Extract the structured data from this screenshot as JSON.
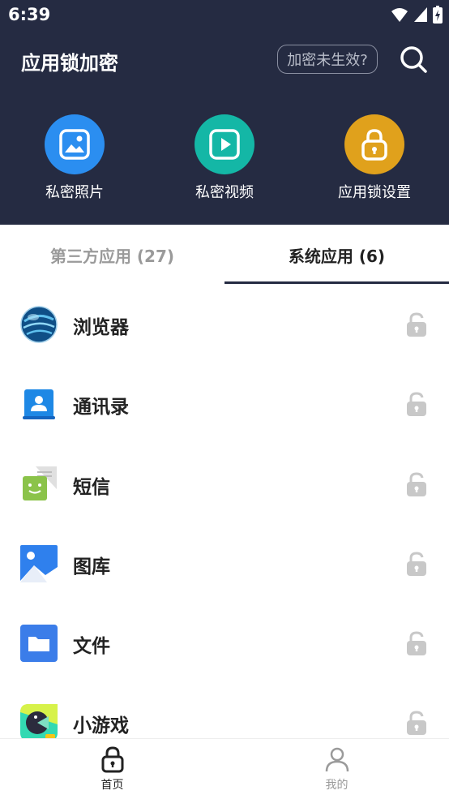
{
  "status_bar": {
    "time": "6:39"
  },
  "header": {
    "title": "应用锁加密",
    "status_pill": "加密未生效?",
    "search_icon": "search-icon"
  },
  "features": [
    {
      "label": "私密照片",
      "icon": "photo-icon",
      "color": "#2b8ef0"
    },
    {
      "label": "私密视频",
      "icon": "video-icon",
      "color": "#14b7a6"
    },
    {
      "label": "应用锁设置",
      "icon": "lock-icon",
      "color": "#e0a11c"
    }
  ],
  "tabs": {
    "third_party": "第三方应用 (27)",
    "system": "系统应用 (6)",
    "active": "system"
  },
  "apps": [
    {
      "name": "浏览器",
      "icon": "browser-icon",
      "locked": false
    },
    {
      "name": "通讯录",
      "icon": "contacts-icon",
      "locked": false
    },
    {
      "name": "短信",
      "icon": "messages-icon",
      "locked": false
    },
    {
      "name": "图库",
      "icon": "gallery-icon",
      "locked": false
    },
    {
      "name": "文件",
      "icon": "files-icon",
      "locked": false
    },
    {
      "name": "小游戏",
      "icon": "game-icon",
      "locked": false
    }
  ],
  "bottom_nav": {
    "home": "首页",
    "mine": "我的",
    "active": "home",
    "active_color": "#222222",
    "inactive_color": "#9a9a9a"
  }
}
